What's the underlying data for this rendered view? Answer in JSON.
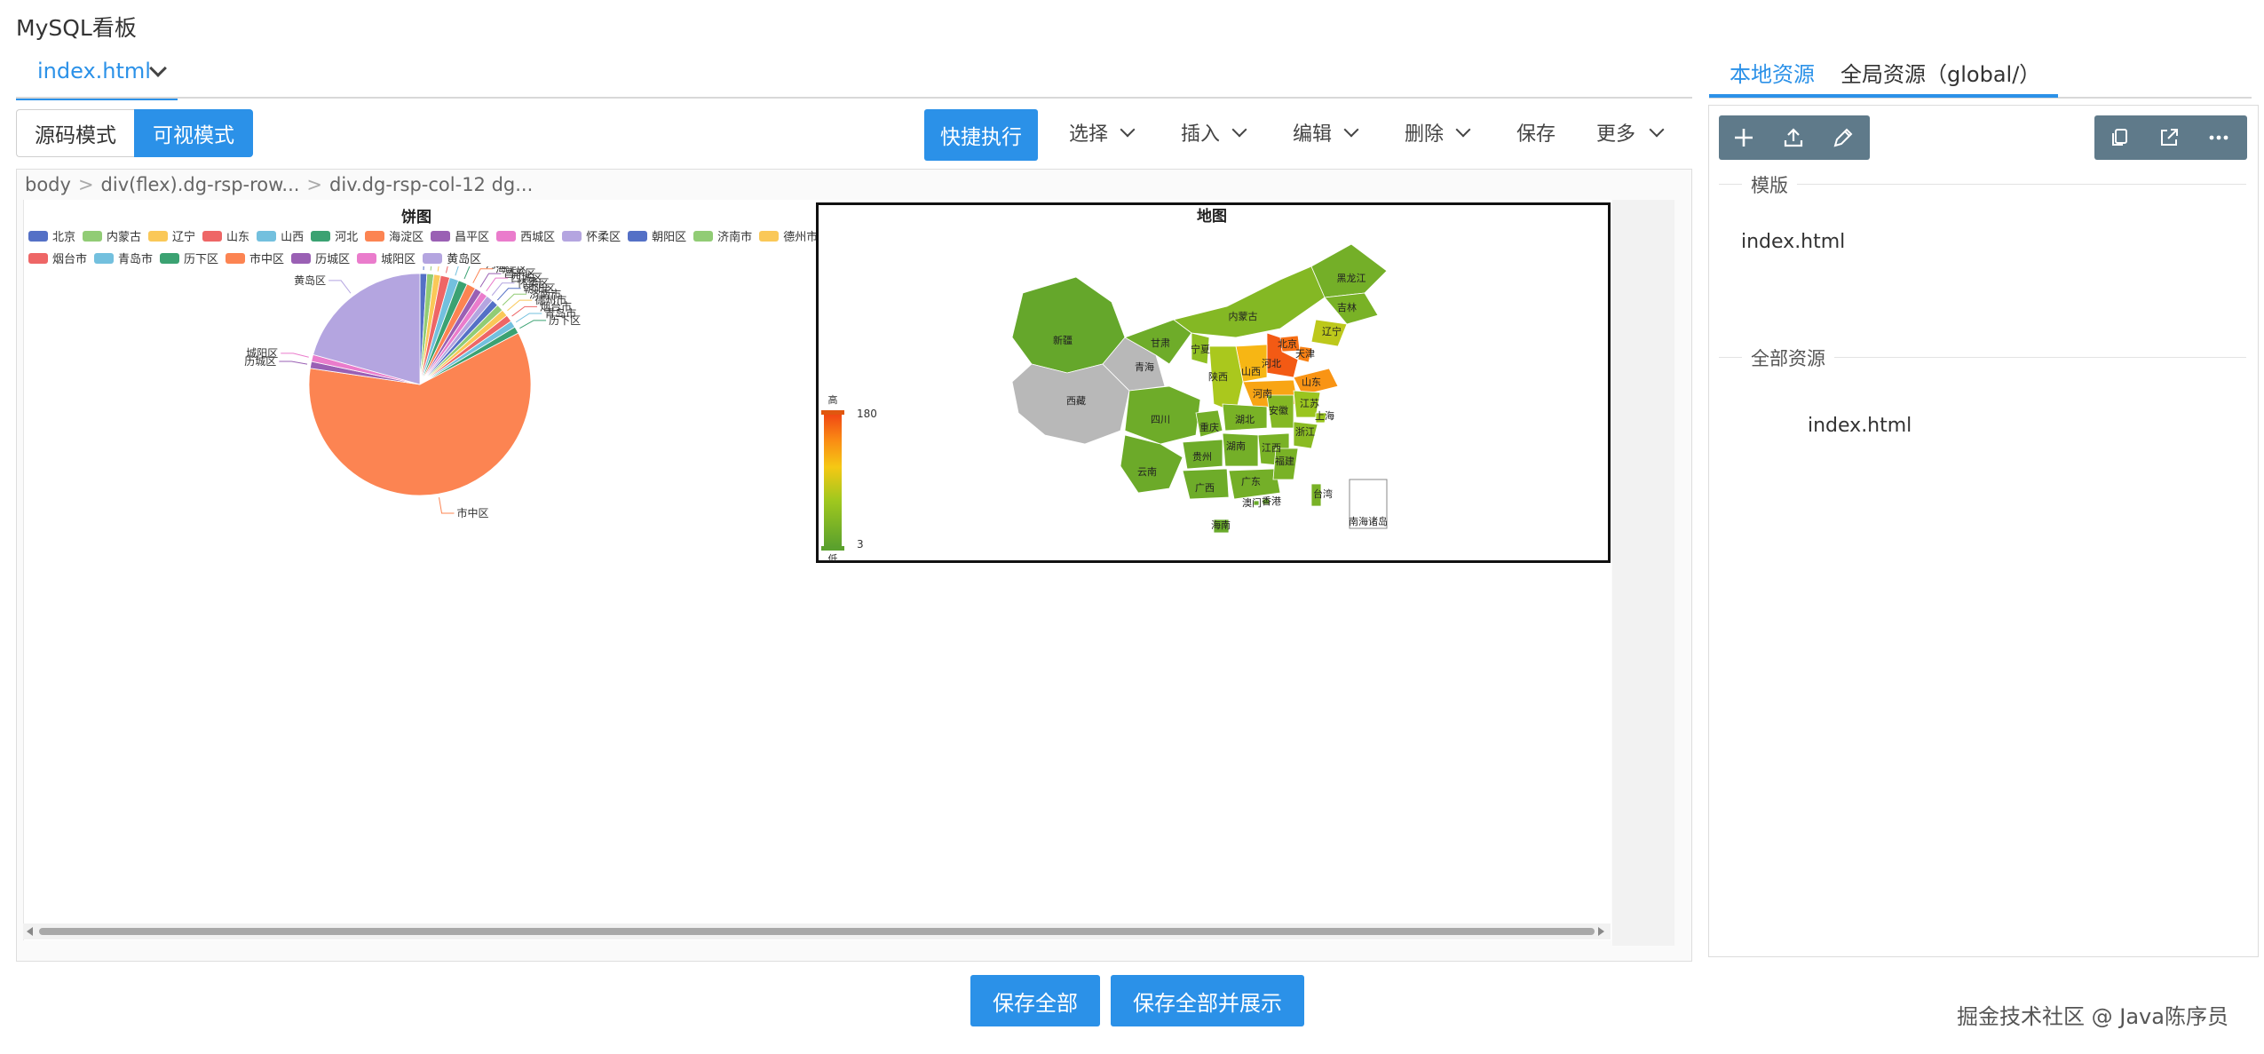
{
  "app": {
    "title": "MySQL看板"
  },
  "file_tab": {
    "label": "index.html"
  },
  "modes": {
    "source": "源码模式",
    "visual": "可视模式"
  },
  "toolbar": {
    "quick_exec": "快捷执行",
    "menus": [
      "选择",
      "插入",
      "编辑",
      "删除"
    ],
    "save": "保存",
    "more": "更多"
  },
  "breadcrumb": [
    "body",
    "div(flex).dg-rsp-row...",
    "div.dg-rsp-col-12 dg..."
  ],
  "pie": {
    "title": "饼图"
  },
  "map": {
    "title": "地图"
  },
  "colors": {
    "accent": "#2b91e8",
    "tool_group": "#5f7a8a",
    "pie_palette": [
      "#5470c6",
      "#91cc75",
      "#fac858",
      "#ee6666",
      "#73c0de",
      "#3ba272",
      "#fc8452",
      "#9a60b4",
      "#ea7ccc",
      "#b4a5e0"
    ]
  },
  "chart_data": [
    {
      "type": "pie",
      "title": "饼图",
      "legend_position": "top",
      "slices": [
        {
          "name": "北京",
          "value": 3,
          "color": "#5470c6"
        },
        {
          "name": "内蒙古",
          "value": 3,
          "color": "#91cc75"
        },
        {
          "name": "辽宁",
          "value": 3,
          "color": "#fac858"
        },
        {
          "name": "山东",
          "value": 4,
          "color": "#ee6666"
        },
        {
          "name": "山西",
          "value": 4,
          "color": "#73c0de"
        },
        {
          "name": "河北",
          "value": 4,
          "color": "#3ba272"
        },
        {
          "name": "海淀区",
          "value": 4,
          "color": "#fc8452"
        },
        {
          "name": "昌平区",
          "value": 3,
          "color": "#9a60b4"
        },
        {
          "name": "西城区",
          "value": 3,
          "color": "#ea7ccc"
        },
        {
          "name": "怀柔区",
          "value": 3,
          "color": "#b4a5e0"
        },
        {
          "name": "朝阳区",
          "value": 3,
          "color": "#5470c6"
        },
        {
          "name": "济南市",
          "value": 3,
          "color": "#91cc75"
        },
        {
          "name": "德州市",
          "value": 3,
          "color": "#fac858"
        },
        {
          "name": "烟台市",
          "value": 3,
          "color": "#ee6666"
        },
        {
          "name": "青岛市",
          "value": 3,
          "color": "#73c0de"
        },
        {
          "name": "历下区",
          "value": 3,
          "color": "#3ba272"
        },
        {
          "name": "市中区",
          "value": 180,
          "color": "#fc8452"
        },
        {
          "name": "历城区",
          "value": 3,
          "color": "#9a60b4"
        },
        {
          "name": "城阳区",
          "value": 3,
          "color": "#ea7ccc"
        },
        {
          "name": "黄岛区",
          "value": 62,
          "color": "#b4a5e0"
        }
      ]
    },
    {
      "type": "map",
      "title": "地图",
      "visual_map": {
        "min": 3,
        "max": 180,
        "high_label": "高",
        "low_label": "低"
      },
      "regions": [
        {
          "name": "新疆",
          "value": 12
        },
        {
          "name": "西藏",
          "value": 0
        },
        {
          "name": "青海",
          "value": 0
        },
        {
          "name": "甘肃",
          "value": 20
        },
        {
          "name": "内蒙古",
          "value": 40
        },
        {
          "name": "黑龙江",
          "value": 25
        },
        {
          "name": "吉林",
          "value": 30
        },
        {
          "name": "辽宁",
          "value": 80
        },
        {
          "name": "北京",
          "value": 160
        },
        {
          "name": "天津",
          "value": 150
        },
        {
          "name": "河北",
          "value": 170
        },
        {
          "name": "山西",
          "value": 120
        },
        {
          "name": "山东",
          "value": 140
        },
        {
          "name": "河南",
          "value": 130
        },
        {
          "name": "宁夏",
          "value": 50
        },
        {
          "name": "陕西",
          "value": 70
        },
        {
          "name": "四川",
          "value": 20
        },
        {
          "name": "重庆",
          "value": 25
        },
        {
          "name": "湖北",
          "value": 30
        },
        {
          "name": "安徽",
          "value": 40
        },
        {
          "name": "江苏",
          "value": 60
        },
        {
          "name": "上海",
          "value": 60
        },
        {
          "name": "浙江",
          "value": 45
        },
        {
          "name": "江西",
          "value": 30
        },
        {
          "name": "湖南",
          "value": 25
        },
        {
          "name": "贵州",
          "value": 20
        },
        {
          "name": "云南",
          "value": 18
        },
        {
          "name": "广西",
          "value": 20
        },
        {
          "name": "广东",
          "value": 25
        },
        {
          "name": "福建",
          "value": 30
        },
        {
          "name": "台湾",
          "value": 30
        },
        {
          "name": "海南",
          "value": 15
        },
        {
          "name": "香港",
          "value": 15
        },
        {
          "name": "澳门",
          "value": 15
        }
      ],
      "inset_label": "南海诸岛"
    }
  ],
  "right_panel": {
    "tabs": [
      "本地资源",
      "全局资源（global/）"
    ],
    "template_section": "模版",
    "template_files": [
      "index.html"
    ],
    "all_section": "全部资源",
    "all_files": [
      "index.html"
    ]
  },
  "bottom": {
    "save_all": "保存全部",
    "save_all_show": "保存全部并展示"
  },
  "watermark": "掘金技术社区 @ Java陈序员"
}
